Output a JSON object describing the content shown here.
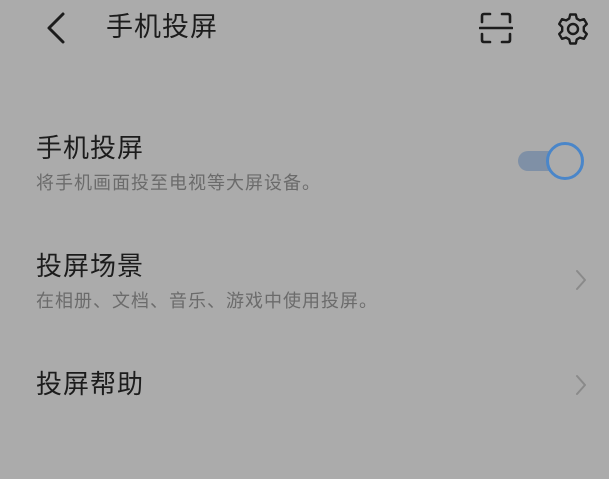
{
  "header": {
    "title": "手机投屏",
    "back_icon": "chevron-left-icon",
    "scan_icon": "scan-icon",
    "settings_icon": "gear-icon"
  },
  "rows": [
    {
      "title": "手机投屏",
      "subtitle": "将手机画面投至电视等大屏设备。",
      "control": "toggle",
      "toggle_on": true
    },
    {
      "title": "投屏场景",
      "subtitle": "在相册、文档、音乐、游戏中使用投屏。",
      "control": "chevron-right-icon"
    },
    {
      "title": "投屏帮助",
      "control": "chevron-right-icon"
    }
  ],
  "colors": {
    "background": "#ababab",
    "primary_text": "#1c1c1c",
    "secondary_text": "#6b6b6b",
    "accent": "#4a86c9",
    "toggle_track": "#7f90a6"
  }
}
